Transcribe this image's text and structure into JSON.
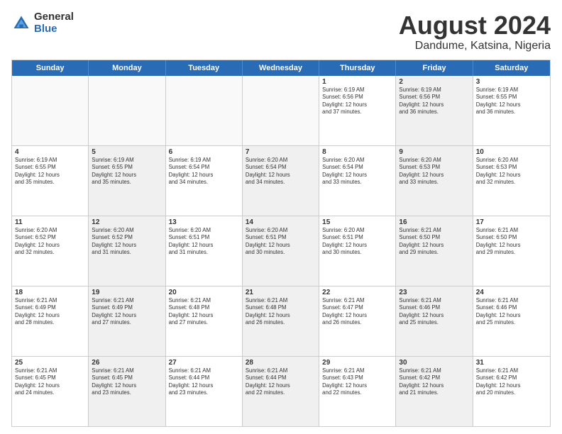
{
  "logo": {
    "general": "General",
    "blue": "Blue"
  },
  "title": "August 2024",
  "subtitle": "Dandume, Katsina, Nigeria",
  "header_days": [
    "Sunday",
    "Monday",
    "Tuesday",
    "Wednesday",
    "Thursday",
    "Friday",
    "Saturday"
  ],
  "weeks": [
    [
      {
        "day": "",
        "info": "",
        "empty": true
      },
      {
        "day": "",
        "info": "",
        "empty": true
      },
      {
        "day": "",
        "info": "",
        "empty": true
      },
      {
        "day": "",
        "info": "",
        "empty": true
      },
      {
        "day": "1",
        "info": "Sunrise: 6:19 AM\nSunset: 6:56 PM\nDaylight: 12 hours\nand 37 minutes.",
        "shaded": false
      },
      {
        "day": "2",
        "info": "Sunrise: 6:19 AM\nSunset: 6:56 PM\nDaylight: 12 hours\nand 36 minutes.",
        "shaded": true
      },
      {
        "day": "3",
        "info": "Sunrise: 6:19 AM\nSunset: 6:55 PM\nDaylight: 12 hours\nand 36 minutes.",
        "shaded": false
      }
    ],
    [
      {
        "day": "4",
        "info": "Sunrise: 6:19 AM\nSunset: 6:55 PM\nDaylight: 12 hours\nand 35 minutes.",
        "shaded": false
      },
      {
        "day": "5",
        "info": "Sunrise: 6:19 AM\nSunset: 6:55 PM\nDaylight: 12 hours\nand 35 minutes.",
        "shaded": true
      },
      {
        "day": "6",
        "info": "Sunrise: 6:19 AM\nSunset: 6:54 PM\nDaylight: 12 hours\nand 34 minutes.",
        "shaded": false
      },
      {
        "day": "7",
        "info": "Sunrise: 6:20 AM\nSunset: 6:54 PM\nDaylight: 12 hours\nand 34 minutes.",
        "shaded": true
      },
      {
        "day": "8",
        "info": "Sunrise: 6:20 AM\nSunset: 6:54 PM\nDaylight: 12 hours\nand 33 minutes.",
        "shaded": false
      },
      {
        "day": "9",
        "info": "Sunrise: 6:20 AM\nSunset: 6:53 PM\nDaylight: 12 hours\nand 33 minutes.",
        "shaded": true
      },
      {
        "day": "10",
        "info": "Sunrise: 6:20 AM\nSunset: 6:53 PM\nDaylight: 12 hours\nand 32 minutes.",
        "shaded": false
      }
    ],
    [
      {
        "day": "11",
        "info": "Sunrise: 6:20 AM\nSunset: 6:52 PM\nDaylight: 12 hours\nand 32 minutes.",
        "shaded": false
      },
      {
        "day": "12",
        "info": "Sunrise: 6:20 AM\nSunset: 6:52 PM\nDaylight: 12 hours\nand 31 minutes.",
        "shaded": true
      },
      {
        "day": "13",
        "info": "Sunrise: 6:20 AM\nSunset: 6:51 PM\nDaylight: 12 hours\nand 31 minutes.",
        "shaded": false
      },
      {
        "day": "14",
        "info": "Sunrise: 6:20 AM\nSunset: 6:51 PM\nDaylight: 12 hours\nand 30 minutes.",
        "shaded": true
      },
      {
        "day": "15",
        "info": "Sunrise: 6:20 AM\nSunset: 6:51 PM\nDaylight: 12 hours\nand 30 minutes.",
        "shaded": false
      },
      {
        "day": "16",
        "info": "Sunrise: 6:21 AM\nSunset: 6:50 PM\nDaylight: 12 hours\nand 29 minutes.",
        "shaded": true
      },
      {
        "day": "17",
        "info": "Sunrise: 6:21 AM\nSunset: 6:50 PM\nDaylight: 12 hours\nand 29 minutes.",
        "shaded": false
      }
    ],
    [
      {
        "day": "18",
        "info": "Sunrise: 6:21 AM\nSunset: 6:49 PM\nDaylight: 12 hours\nand 28 minutes.",
        "shaded": false
      },
      {
        "day": "19",
        "info": "Sunrise: 6:21 AM\nSunset: 6:49 PM\nDaylight: 12 hours\nand 27 minutes.",
        "shaded": true
      },
      {
        "day": "20",
        "info": "Sunrise: 6:21 AM\nSunset: 6:48 PM\nDaylight: 12 hours\nand 27 minutes.",
        "shaded": false
      },
      {
        "day": "21",
        "info": "Sunrise: 6:21 AM\nSunset: 6:48 PM\nDaylight: 12 hours\nand 26 minutes.",
        "shaded": true
      },
      {
        "day": "22",
        "info": "Sunrise: 6:21 AM\nSunset: 6:47 PM\nDaylight: 12 hours\nand 26 minutes.",
        "shaded": false
      },
      {
        "day": "23",
        "info": "Sunrise: 6:21 AM\nSunset: 6:46 PM\nDaylight: 12 hours\nand 25 minutes.",
        "shaded": true
      },
      {
        "day": "24",
        "info": "Sunrise: 6:21 AM\nSunset: 6:46 PM\nDaylight: 12 hours\nand 25 minutes.",
        "shaded": false
      }
    ],
    [
      {
        "day": "25",
        "info": "Sunrise: 6:21 AM\nSunset: 6:45 PM\nDaylight: 12 hours\nand 24 minutes.",
        "shaded": false
      },
      {
        "day": "26",
        "info": "Sunrise: 6:21 AM\nSunset: 6:45 PM\nDaylight: 12 hours\nand 23 minutes.",
        "shaded": true
      },
      {
        "day": "27",
        "info": "Sunrise: 6:21 AM\nSunset: 6:44 PM\nDaylight: 12 hours\nand 23 minutes.",
        "shaded": false
      },
      {
        "day": "28",
        "info": "Sunrise: 6:21 AM\nSunset: 6:44 PM\nDaylight: 12 hours\nand 22 minutes.",
        "shaded": true
      },
      {
        "day": "29",
        "info": "Sunrise: 6:21 AM\nSunset: 6:43 PM\nDaylight: 12 hours\nand 22 minutes.",
        "shaded": false
      },
      {
        "day": "30",
        "info": "Sunrise: 6:21 AM\nSunset: 6:42 PM\nDaylight: 12 hours\nand 21 minutes.",
        "shaded": true
      },
      {
        "day": "31",
        "info": "Sunrise: 6:21 AM\nSunset: 6:42 PM\nDaylight: 12 hours\nand 20 minutes.",
        "shaded": false
      }
    ]
  ]
}
